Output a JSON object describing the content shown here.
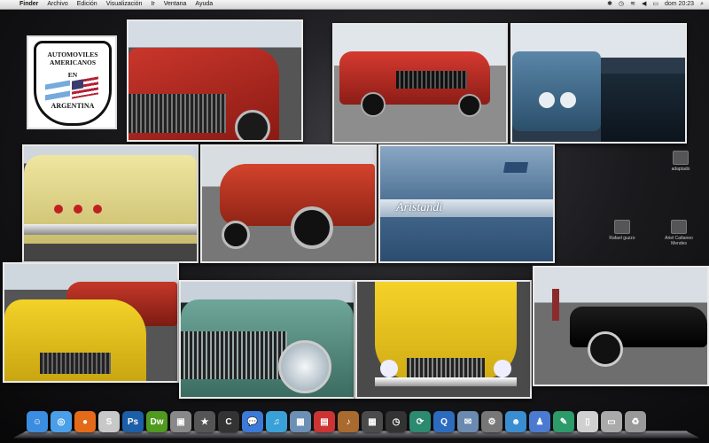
{
  "menubar": {
    "apple_icon": "apple-icon",
    "app_name": "Finder",
    "menus": [
      "Archivo",
      "Edición",
      "Visualización",
      "Ir",
      "Ventana",
      "Ayuda"
    ],
    "clock": "dom 20:23"
  },
  "logo": {
    "line1": "AUTOMOVILES",
    "line2": "AMERICANOS",
    "line3": "EN",
    "line4": "ARGENTINA"
  },
  "photo8": {
    "script_text": "Aristandi"
  },
  "desktop_icons": [
    {
      "label": "adaptado"
    },
    {
      "label": "Rafael guzzo"
    },
    {
      "label": "Ariel Cattaneo Mendes"
    }
  ],
  "dock": {
    "items": [
      {
        "name": "finder-icon",
        "glyph": "☺",
        "color": "#3a8de0"
      },
      {
        "name": "safari-icon",
        "glyph": "◎",
        "color": "#4a9fe8"
      },
      {
        "name": "firefox-icon",
        "glyph": "●",
        "color": "#e46a1a"
      },
      {
        "name": "app-icon",
        "glyph": "S",
        "color": "#c8c8c8"
      },
      {
        "name": "photoshop-icon",
        "glyph": "Ps",
        "color": "#1c5fa8"
      },
      {
        "name": "dreamweaver-icon",
        "glyph": "Dw",
        "color": "#4f9a1f"
      },
      {
        "name": "preview-icon",
        "glyph": "▣",
        "color": "#888"
      },
      {
        "name": "imovie-icon",
        "glyph": "★",
        "color": "#555"
      },
      {
        "name": "comic-icon",
        "glyph": "C",
        "color": "#333"
      },
      {
        "name": "ichat-icon",
        "glyph": "💬",
        "color": "#3b7ad8"
      },
      {
        "name": "itunes-icon",
        "glyph": "♫",
        "color": "#3aa0d8"
      },
      {
        "name": "iphoto-icon",
        "glyph": "▦",
        "color": "#6b8fb5"
      },
      {
        "name": "pdf-icon",
        "glyph": "▤",
        "color": "#c33"
      },
      {
        "name": "garageband-icon",
        "glyph": "♪",
        "color": "#a86a2e"
      },
      {
        "name": "dashboard-icon",
        "glyph": "▦",
        "color": "#4b4b4b"
      },
      {
        "name": "timemachine-icon",
        "glyph": "◷",
        "color": "#333"
      },
      {
        "name": "sync-icon",
        "glyph": "⟳",
        "color": "#2b8a6f"
      },
      {
        "name": "quicktime-icon",
        "glyph": "Q",
        "color": "#2b6cbf"
      },
      {
        "name": "mail-icon",
        "glyph": "✉",
        "color": "#6a8ab0"
      },
      {
        "name": "system-prefs-icon",
        "glyph": "⚙",
        "color": "#777"
      },
      {
        "name": "users-icon",
        "glyph": "☻",
        "color": "#3a8dd0"
      },
      {
        "name": "person-icon",
        "glyph": "♟",
        "color": "#4a7bd0"
      },
      {
        "name": "feather-icon",
        "glyph": "✎",
        "color": "#2d9a6a"
      },
      {
        "name": "document-icon",
        "glyph": "▯",
        "color": "#d0d0d0"
      },
      {
        "name": "downloads-icon",
        "glyph": "▭",
        "color": "#aaa"
      },
      {
        "name": "trash-icon",
        "glyph": "♻",
        "color": "#999"
      }
    ]
  }
}
